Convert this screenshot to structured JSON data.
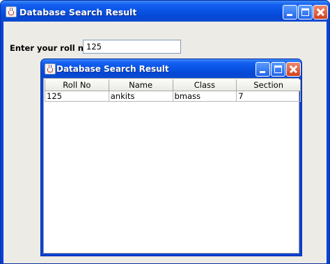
{
  "outer_window": {
    "title": "Database Search Result",
    "roll_label": "Enter your roll no",
    "roll_value": "125"
  },
  "inner_window": {
    "title": "Database Search Result",
    "table": {
      "columns": [
        "Roll No",
        "Name",
        "Class",
        "Section"
      ],
      "rows": [
        [
          "125",
          "ankits",
          "bmass",
          "7"
        ]
      ]
    }
  },
  "theme": {
    "titlebar_blue": "#0a55e6",
    "close_red": "#d0401c",
    "client_bg": "#ecebe6"
  }
}
